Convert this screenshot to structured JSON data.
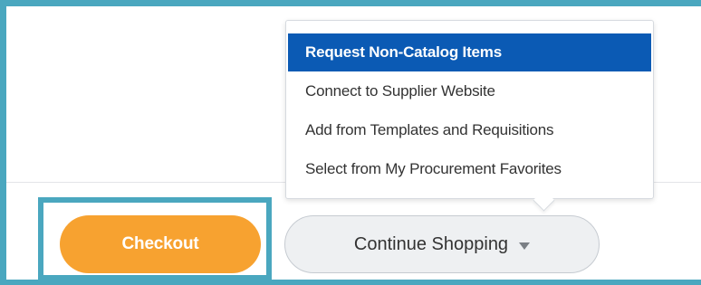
{
  "colors": {
    "frame": "#4aa7bf",
    "checkout_bg": "#f7a230",
    "menu_active_bg": "#0b5ab4",
    "secondary_button_bg": "#eef0f2"
  },
  "dropdown_menu": {
    "items": [
      {
        "label": "Request Non-Catalog Items",
        "active": true
      },
      {
        "label": "Connect to Supplier Website",
        "active": false
      },
      {
        "label": "Add from Templates and Requisitions",
        "active": false
      },
      {
        "label": "Select from My Procurement Favorites",
        "active": false
      }
    ]
  },
  "actions": {
    "checkout_label": "Checkout",
    "continue_label": "Continue Shopping",
    "continue_icon": "caret-down-icon"
  }
}
